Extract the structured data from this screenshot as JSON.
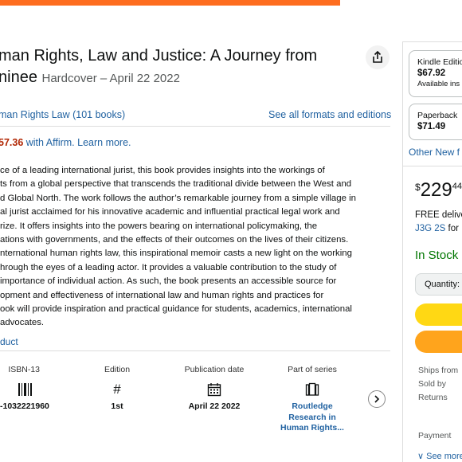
{
  "product": {
    "title_line1": "man Rights, Law and Justice: A Journey from",
    "title_line2": "ninee",
    "format_date": "Hardcover – April 22 2022",
    "series_link": "man Rights Law (101 books)",
    "formats_link": "See all formats and editions",
    "affirm_price": "57.36",
    "affirm_text": " with Affirm. Learn more.",
    "description": [
      "ce of a leading international jurist, this book provides insights into the workings of",
      "ts from a global perspective that transcends the traditional divide between the West and",
      "d Global North. The work follows the author’s remarkable journey from a simple village in",
      "al jurist acclaimed for his innovative academic and influential practical legal work and",
      "rize. It offers insights into the powers bearing on international policymaking, the",
      "ations with governments, and the effects of their outcomes on the lives of their citizens.",
      "nternational human rights law, this inspirational memoir casts a new light on the working",
      "hrough the eyes of a leading actor. It provides a valuable contribution to the study of",
      "importance of individual action. As such, the book presents an accessible source for",
      "opment and effectiveness of international law and human rights and practices for",
      "ook will provide inspiration and practical guidance for students, academics, international",
      " advocates."
    ],
    "read_more": "duct"
  },
  "details": {
    "isbn_label": "ISBN-13",
    "isbn_value": "-1032221960",
    "isbn_icon": "barcode-icon",
    "edition_label": "Edition",
    "edition_value": "1st",
    "edition_icon": "hash-icon",
    "pubdate_label": "Publication date",
    "pubdate_value": "April 22 2022",
    "pubdate_icon": "calendar-icon",
    "series_label": "Part of series",
    "series_value": "Routledge Research in Human Rights...",
    "series_icon": "books-icon"
  },
  "buybox": {
    "kindle_label": "Kindle Editio",
    "kindle_price": "$67.92",
    "kindle_avail": "Available ins",
    "paperback_label": "Paperback",
    "paperback_price": "$71.49",
    "other_new": "Other New f",
    "price_symbol": "$",
    "price_whole": "229",
    "price_fraction": "44",
    "free_delivery": "FREE delive",
    "delivery_link": "J3G 2S",
    "delivery_rest": " for",
    "in_stock": "In Stock",
    "quantity": "Quantity:",
    "ships_from": "Ships from",
    "sold_by": "Sold by",
    "returns": "Returns",
    "payment": "Payment",
    "see_more": "∨ See more"
  },
  "colors": {
    "accent_orange": "#fe6d1f",
    "link": "#2162a1",
    "price_red": "#b12704",
    "in_stock_green": "#007600",
    "add_to_cart": "#ffd814",
    "buy_now": "#ffa41c"
  }
}
